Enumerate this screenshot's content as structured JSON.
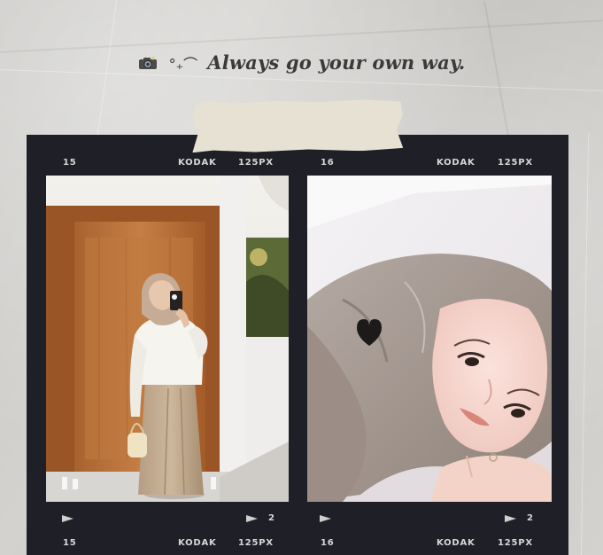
{
  "caption": {
    "emoji_icon": "camera-with-flash-icon",
    "symbols": "°₊⌒",
    "text": "Always go your own way."
  },
  "film_strip": {
    "top_labels": {
      "left_frame_number": "15",
      "left_brand": "KODAK",
      "left_format": "125PX",
      "right_frame_number": "16",
      "right_brand": "KODAK",
      "right_format": "125PX"
    },
    "bottom_markers": {
      "left_arrow_label": "2",
      "right_arrow_label": "2"
    },
    "bottom_labels": {
      "left_frame_number": "15",
      "left_brand": "KODAK",
      "left_format": "125PX",
      "right_frame_number": "16",
      "right_brand": "KODAK",
      "right_format": "125PX"
    }
  },
  "photos": {
    "left": "mirror-selfie-photo",
    "right": "close-up-selfie-photo"
  },
  "colors": {
    "paper": "#d3d2cf",
    "film": "#1f2027",
    "tape": "#e6e1d2"
  }
}
